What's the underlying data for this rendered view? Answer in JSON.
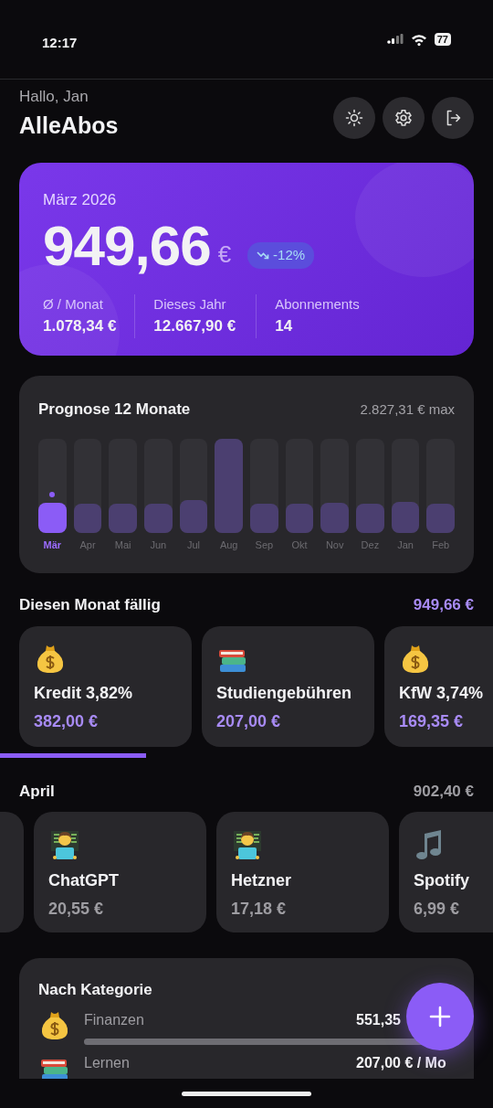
{
  "status_bar": {
    "time": "12:17",
    "battery": "77"
  },
  "header": {
    "greeting": "Hallo, Jan",
    "title": "AlleAbos",
    "buttons": [
      {
        "kind": "theme"
      },
      {
        "kind": "settings"
      },
      {
        "kind": "logout"
      }
    ]
  },
  "summary": {
    "month": "März 2026",
    "amount": "949,66",
    "currency": "€",
    "trend": "-12%",
    "stats": [
      {
        "label": "Ø / Monat",
        "value": "1.078,34 €"
      },
      {
        "label": "Dieses Jahr",
        "value": "12.667,90 €"
      },
      {
        "label": "Abonnements",
        "value": "14"
      }
    ]
  },
  "forecast": {
    "title": "Prognose 12 Monate",
    "max": "2.827,31 € max",
    "months": [
      {
        "label": "Mär",
        "level": 0.32,
        "selected": true
      },
      {
        "label": "Apr",
        "level": 0.31,
        "selected": false
      },
      {
        "label": "Mai",
        "level": 0.31,
        "selected": false
      },
      {
        "label": "Jun",
        "level": 0.31,
        "selected": false
      },
      {
        "label": "Jul",
        "level": 0.34,
        "selected": false
      },
      {
        "label": "Aug",
        "level": 1.0,
        "selected": false
      },
      {
        "label": "Sep",
        "level": 0.31,
        "selected": false
      },
      {
        "label": "Okt",
        "level": 0.31,
        "selected": false
      },
      {
        "label": "Nov",
        "level": 0.32,
        "selected": false
      },
      {
        "label": "Dez",
        "level": 0.31,
        "selected": false
      },
      {
        "label": "Jan",
        "level": 0.33,
        "selected": false
      },
      {
        "label": "Feb",
        "level": 0.31,
        "selected": false
      }
    ]
  },
  "due": {
    "title": "Diesen Monat fällig",
    "total": "949,66 €",
    "items": [
      {
        "kind": "money",
        "name": "Kredit 3,82%",
        "amount": "382,00 €"
      },
      {
        "kind": "books",
        "name": "Studiengebühren",
        "amount": "207,00 €"
      },
      {
        "kind": "money",
        "name": "KfW 3,74%",
        "amount": "169,35 €"
      }
    ]
  },
  "upcoming": {
    "title": "April",
    "total": "902,40 €",
    "items": [
      {
        "kind": "coder",
        "name": "ChatGPT",
        "amount": "20,55 €"
      },
      {
        "kind": "coder",
        "name": "Hetzner",
        "amount": "17,18 €"
      },
      {
        "kind": "music",
        "name": "Spotify",
        "amount": "6,99 €"
      }
    ]
  },
  "categories": {
    "title": "Nach Kategorie",
    "items": [
      {
        "kind": "money",
        "name": "Finanzen",
        "amount": "551,35",
        "level": 1.0
      },
      {
        "kind": "books",
        "name": "Lernen",
        "amount": "207,00 € / Mo"
      }
    ]
  }
}
